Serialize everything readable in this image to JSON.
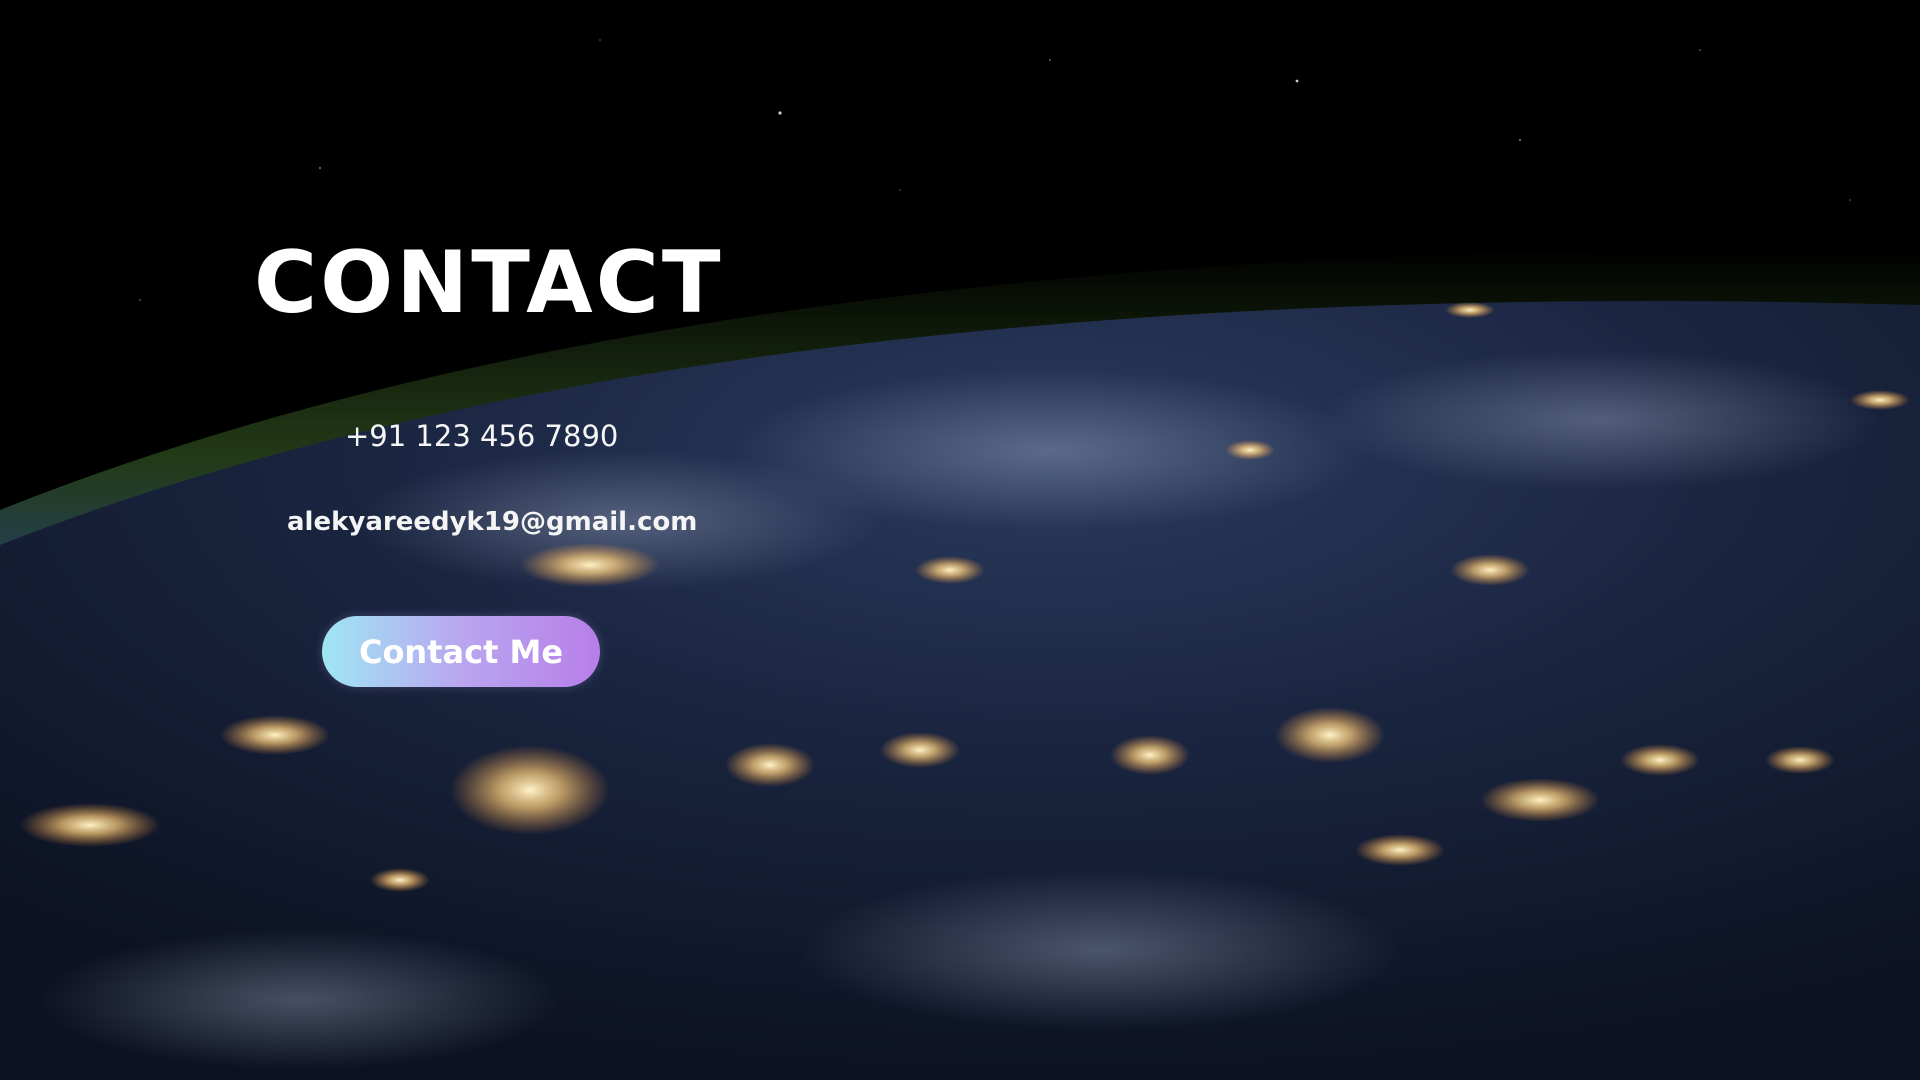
{
  "contact": {
    "heading": "CONTACT",
    "phone": "+91 123 456 7890",
    "email": "alekyareedyk19@gmail.com",
    "button_label": "Contact Me"
  },
  "background": {
    "image": "earth-at-night-from-space",
    "space_color": "#000000",
    "ocean_color": "#1b2740",
    "atmosphere_color": "#3f6a2a",
    "city_light_color": "#ffd68a"
  },
  "colors": {
    "text": "#ffffff",
    "button_gradient_start": "#9fe6f4",
    "button_gradient_end": "#b77ee8"
  }
}
